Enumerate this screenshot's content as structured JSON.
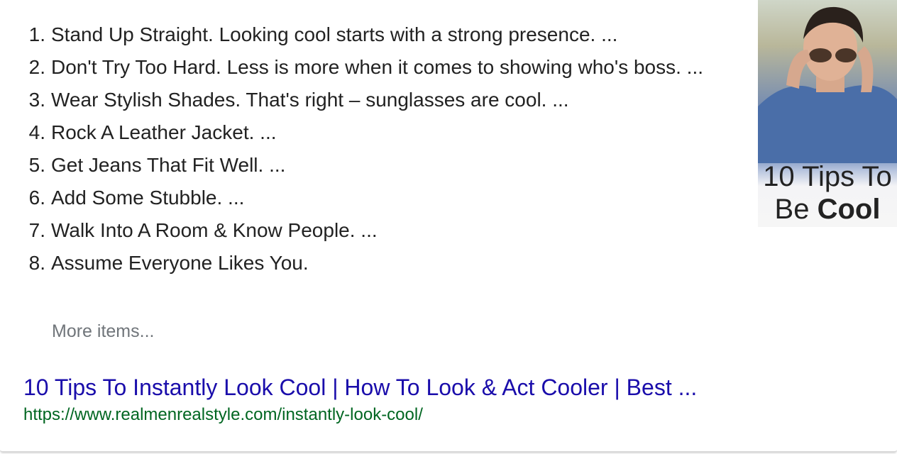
{
  "list": [
    {
      "number": "1.",
      "text": "Stand Up Straight. Looking cool starts with a strong presence. ..."
    },
    {
      "number": "2.",
      "text": "Don't Try Too Hard. Less is more when it comes to showing who's boss. ..."
    },
    {
      "number": "3.",
      "text": "Wear Stylish Shades. That's right – sunglasses are cool. ..."
    },
    {
      "number": "4.",
      "text": "Rock A Leather Jacket. ..."
    },
    {
      "number": "5.",
      "text": "Get Jeans That Fit Well. ..."
    },
    {
      "number": "6.",
      "text": "Add Some Stubble. ..."
    },
    {
      "number": "7.",
      "text": "Walk Into A Room & Know People. ..."
    },
    {
      "number": "8.",
      "text": "Assume Everyone Likes You."
    }
  ],
  "more_items": "More items...",
  "result": {
    "title": "10 Tips To Instantly Look Cool | How To Look & Act Cooler | Best ...",
    "url": "https://www.realmenrealstyle.com/instantly-look-cool/"
  },
  "thumbnail": {
    "line1": "10 Tips To",
    "line2a": "Be ",
    "line2b": "Cool"
  },
  "colors": {
    "link": "#1a0dab",
    "url": "#006621",
    "muted": "#70757a"
  }
}
